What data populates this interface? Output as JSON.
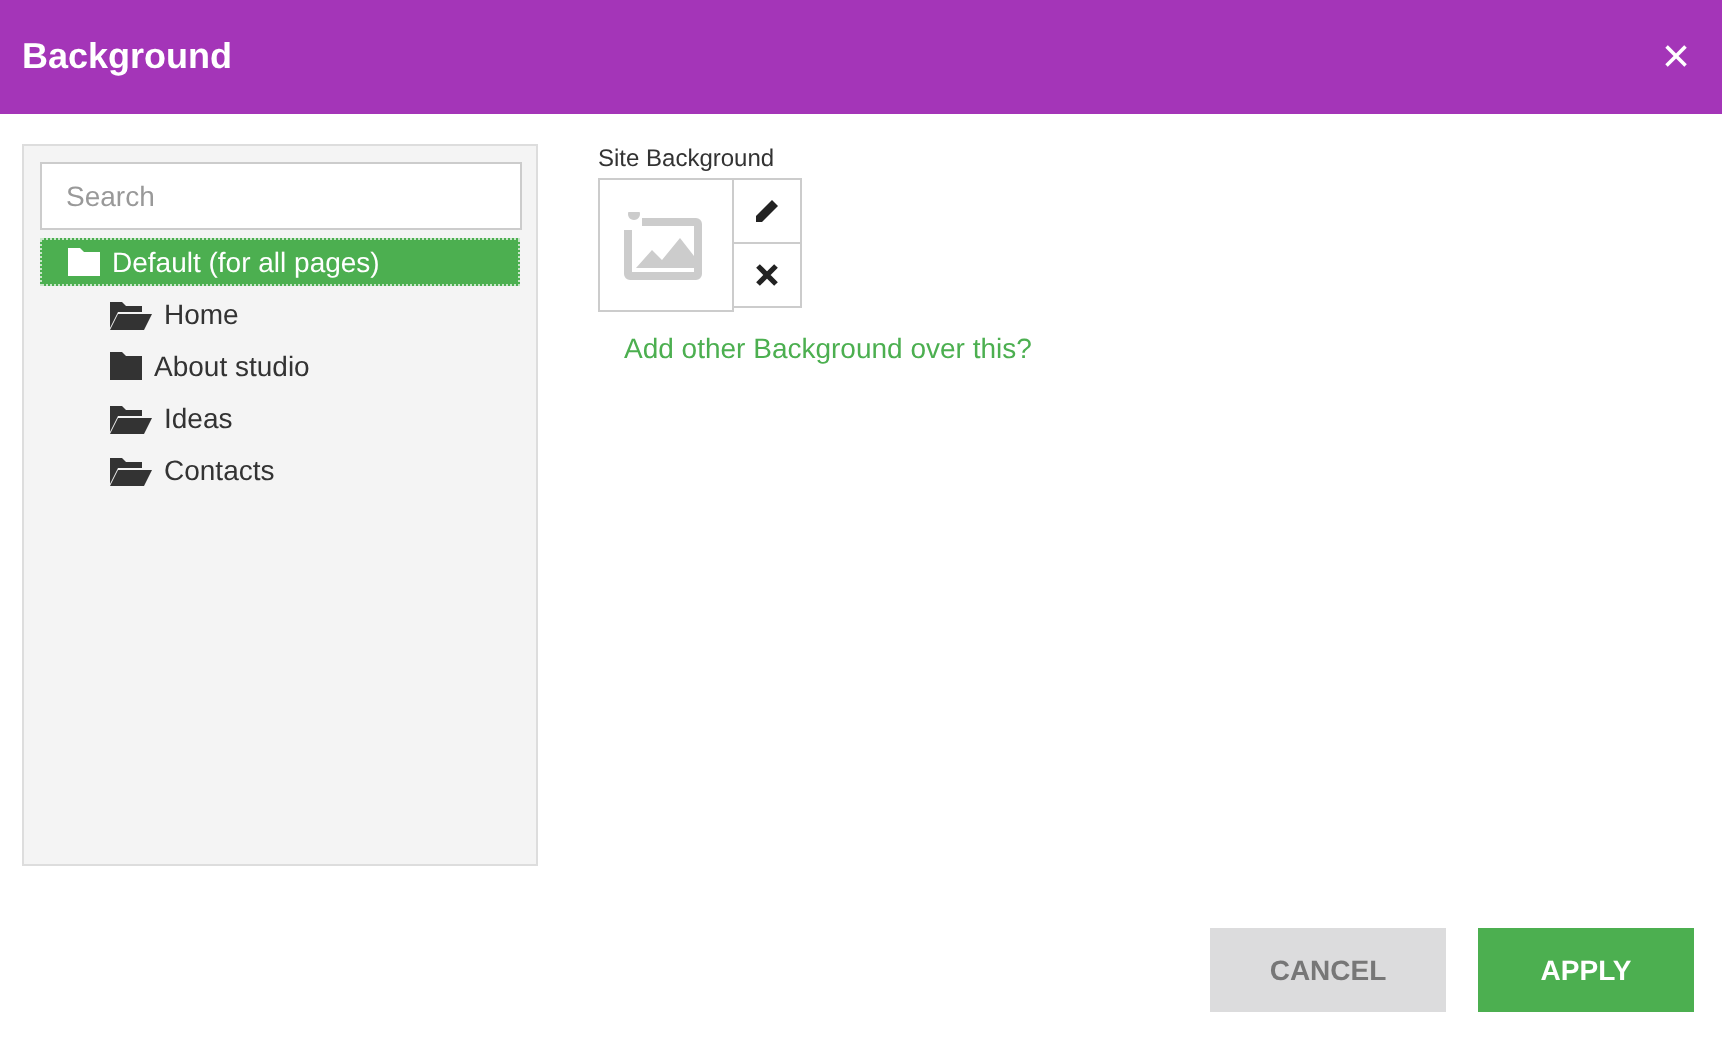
{
  "dialog": {
    "title": "Background",
    "close": "×"
  },
  "search": {
    "placeholder": "Search"
  },
  "tree": [
    {
      "label": "Default (for all pages)",
      "selected": true,
      "folder_open": false,
      "children": [
        {
          "label": "Home",
          "selected": false,
          "folder_open": true
        },
        {
          "label": "About studio",
          "selected": false,
          "folder_open": false
        },
        {
          "label": "Ideas",
          "selected": false,
          "folder_open": true
        },
        {
          "label": "Contacts",
          "selected": false,
          "folder_open": true
        }
      ]
    }
  ],
  "background": {
    "label": "Site Background",
    "link": "Add other Background over this?"
  },
  "buttons": [
    {
      "label": "CANCEL",
      "kind": "secondary"
    },
    {
      "label": "APPLY",
      "kind": "primary"
    }
  ]
}
